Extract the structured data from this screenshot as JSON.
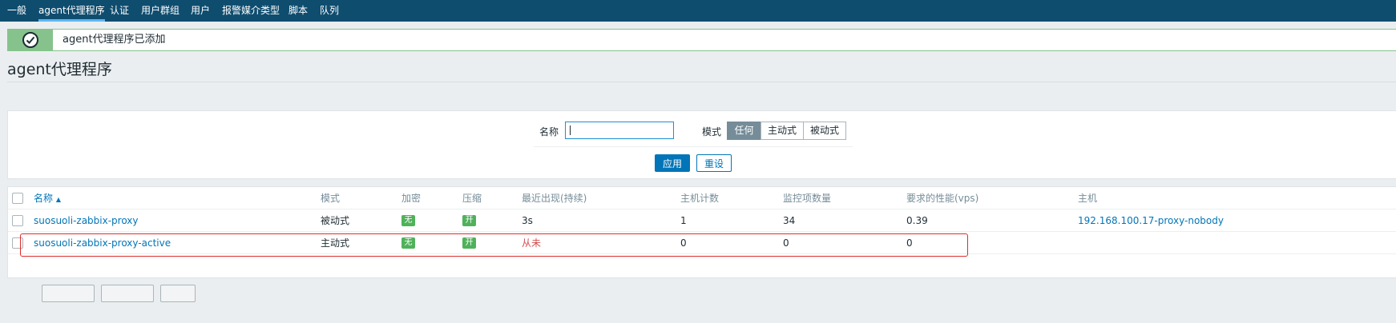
{
  "topnav": {
    "items": [
      {
        "label": "一般",
        "active": false
      },
      {
        "label": "agent代理程序",
        "active": true
      },
      {
        "label": "认证",
        "active": false
      },
      {
        "label": "用户群组",
        "active": false
      },
      {
        "label": "用户",
        "active": false
      },
      {
        "label": "报警媒介类型",
        "active": false
      },
      {
        "label": "脚本",
        "active": false
      },
      {
        "label": "队列",
        "active": false
      }
    ]
  },
  "message": {
    "text": "agent代理程序已添加",
    "icon": "check-circle-icon"
  },
  "page": {
    "title": "agent代理程序"
  },
  "filter": {
    "name_label": "名称",
    "name_value": "",
    "mode_label": "模式",
    "mode_options": [
      "任何",
      "主动式",
      "被动式"
    ],
    "mode_selected": "任何",
    "apply_label": "应用",
    "reset_label": "重设"
  },
  "table": {
    "columns": [
      "名称",
      "模式",
      "加密",
      "压缩",
      "最近出现(持续)",
      "主机计数",
      "监控项数量",
      "要求的性能(vps)",
      "主机"
    ],
    "sort_indicator": "▲",
    "rows": [
      {
        "name": "suosuoli-zabbix-proxy",
        "mode": "被动式",
        "encryption": "无",
        "compression": "开",
        "last_seen": "3s",
        "host_count": "1",
        "item_count": "34",
        "required_vps": "0.39",
        "hosts": "192.168.100.17-proxy-nobody"
      },
      {
        "name": "suosuoli-zabbix-proxy-active",
        "mode": "主动式",
        "encryption": "无",
        "compression": "开",
        "last_seen": "从未",
        "host_count": "0",
        "item_count": "0",
        "required_vps": "0",
        "hosts": ""
      }
    ]
  },
  "colors": {
    "nav_bg": "#0f4d6f",
    "accent": "#0275b8",
    "success": "#86c38c",
    "tag_green": "#4fb25a",
    "never_red": "#d64e4e",
    "highlight_red": "#e22b2b"
  }
}
